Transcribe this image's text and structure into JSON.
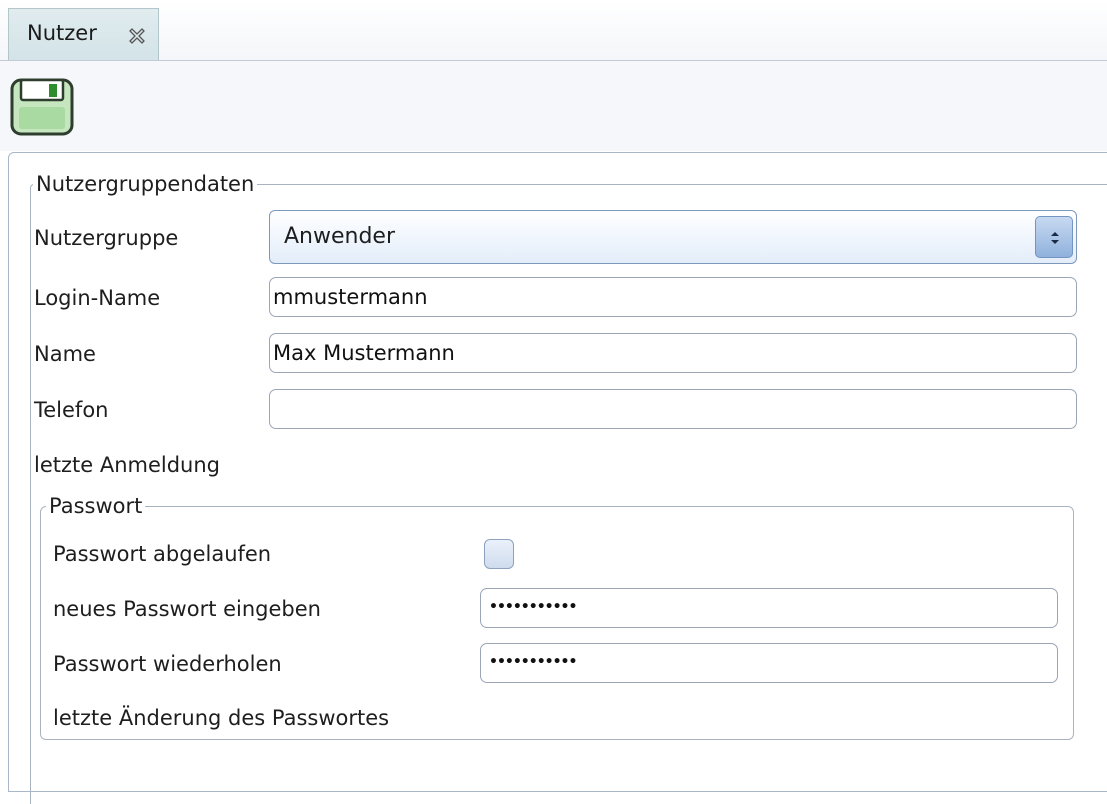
{
  "tab": {
    "label": "Nutzer",
    "close_icon": "close-x-icon"
  },
  "toolbar": {
    "save_icon": "floppy-disk-icon"
  },
  "group": {
    "legend": "Nutzergruppendaten",
    "nutzergruppe": {
      "label": "Nutzergruppe",
      "value": "Anwender"
    },
    "login": {
      "label": "Login-Name",
      "value": "mmustermann"
    },
    "name": {
      "label": "Name",
      "value": "Max Mustermann"
    },
    "telefon": {
      "label": "Telefon",
      "value": ""
    },
    "letzte_anmeldung": {
      "label": "letzte Anmeldung"
    }
  },
  "password": {
    "legend": "Passwort",
    "expired": {
      "label": "Passwort abgelaufen",
      "checked": false
    },
    "new": {
      "label": "neues Passwort eingeben",
      "masked": "•••••••••••"
    },
    "repeat": {
      "label": "Passwort wiederholen",
      "masked": "•••••••••••"
    },
    "last_change": {
      "label": "letzte Änderung des Passwortes"
    }
  },
  "colors": {
    "tab_bg": "#d3e3e7",
    "select_accent": "#8fb1dc",
    "save_icon_green": "#3a9a3a"
  }
}
